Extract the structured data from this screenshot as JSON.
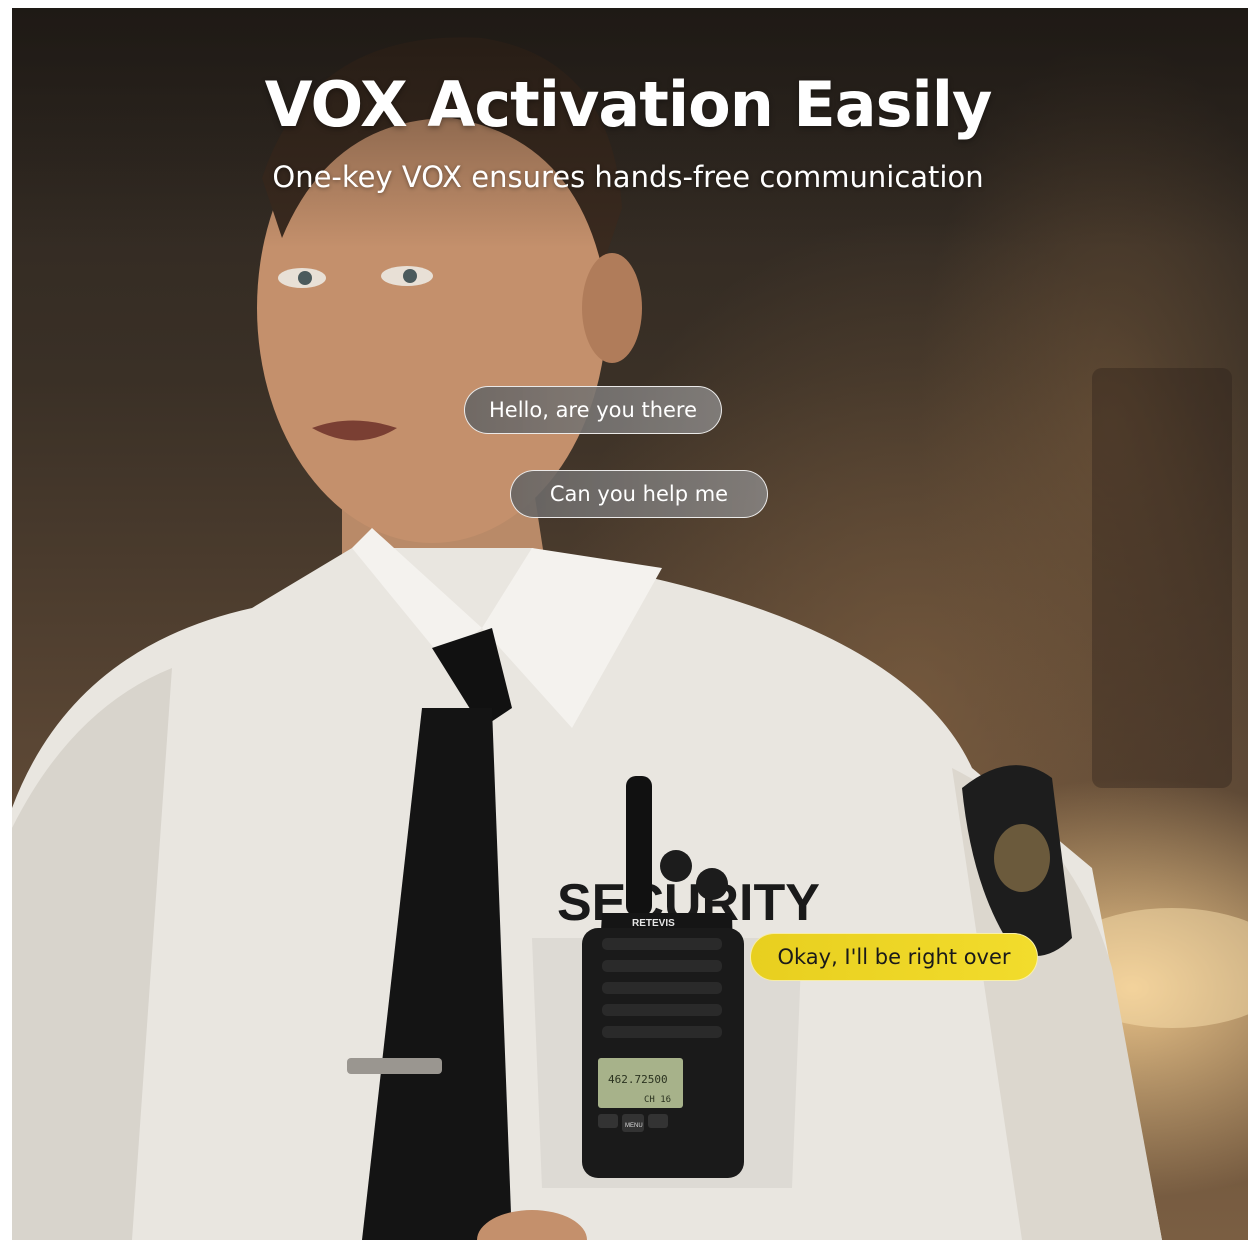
{
  "headline": "VOX Activation Easily",
  "subheadline": "One-key VOX ensures hands-free communication",
  "bubbles": [
    {
      "text": "Hello, are you there",
      "style": "grey"
    },
    {
      "text": "Can you help me",
      "style": "grey"
    },
    {
      "text": "Okay, I'll be right over",
      "style": "yellow"
    }
  ],
  "shirt_text": "SECURITY",
  "radio": {
    "brand": "RETEVIS",
    "display_frequency": "462.72500",
    "display_channel": "CH 16",
    "menu_label": "MENU"
  },
  "colors": {
    "bubble_grey": "#7a7775",
    "bubble_yellow": "#efd928",
    "headline_text": "#ffffff"
  }
}
